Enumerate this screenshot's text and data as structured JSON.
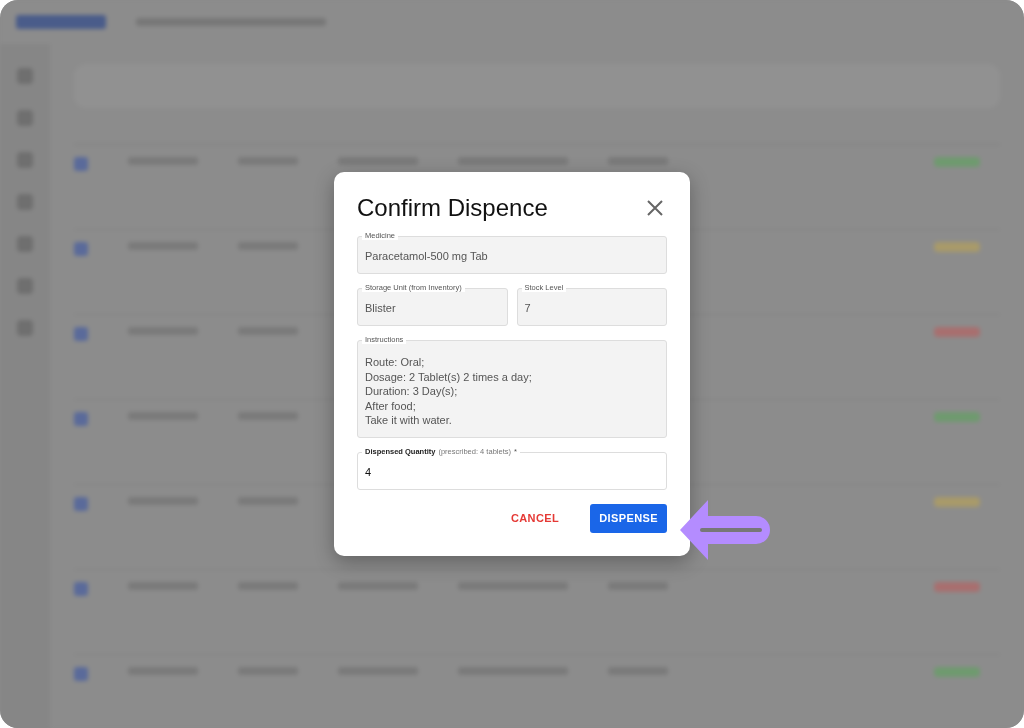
{
  "dialog": {
    "title": "Confirm Dispence",
    "rows": [
      {
        "fields": [
          {
            "kind": "readonly",
            "label": "Medicine",
            "value": "Paracetamol-500 mg Tab"
          }
        ]
      },
      {
        "fields": [
          {
            "kind": "readonly",
            "label": "Storage Unit (from Inventory)",
            "value": "Blister"
          },
          {
            "kind": "readonly",
            "label": "Stock Level",
            "value": "7"
          }
        ]
      },
      {
        "fields": [
          {
            "kind": "multiline",
            "label": "Instructions",
            "lines": [
              "Route: Oral;",
              "Dosage: 2 Tablet(s) 2 times a day;",
              "Duration: 3 Day(s);",
              "After food;",
              "Take it with water."
            ]
          }
        ]
      },
      {
        "fields": [
          {
            "kind": "input",
            "label": "Dispensed Quantity",
            "hint": "(prescribed: 4 tablets)",
            "required_mark": "*",
            "value": "4"
          }
        ]
      }
    ],
    "buttons": [
      {
        "kind": "text",
        "label": "CANCEL"
      },
      {
        "kind": "primary",
        "label": "DISPENSE"
      }
    ]
  }
}
